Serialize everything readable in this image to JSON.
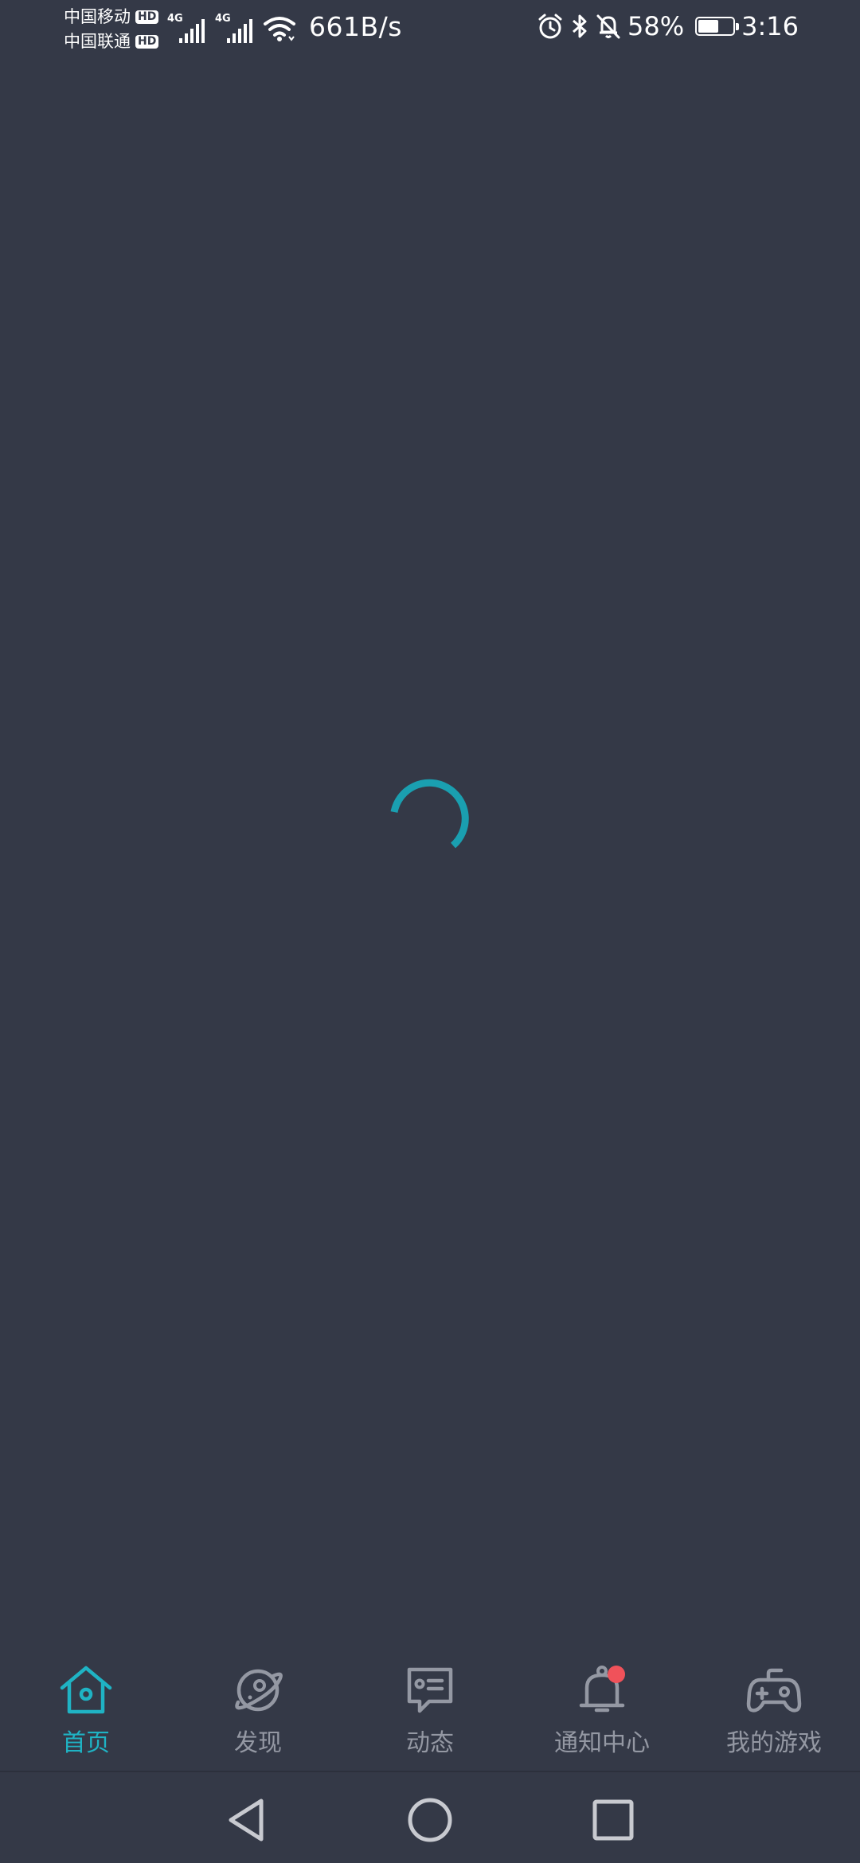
{
  "status_bar": {
    "carrier_1": "中国移动",
    "carrier_2": "中国联通",
    "hd_label": "HD",
    "signal_label": "4G",
    "net_speed": "661B/s",
    "battery_percent": "58%",
    "battery_level": 0.58,
    "time": "3:16",
    "icons": [
      "alarm-icon",
      "bluetooth-icon",
      "mute-bell-icon",
      "wifi-icon",
      "signal-icon",
      "battery-icon"
    ]
  },
  "loading": {
    "icon": "loading-spinner-icon",
    "color": "#1a9fb0"
  },
  "bottom_nav": {
    "active_color": "#1fb3c4",
    "inactive_color": "#9498a3",
    "badge_color": "#f0525a",
    "items": [
      {
        "label": "首页",
        "icon": "home-icon",
        "active": true
      },
      {
        "label": "发现",
        "icon": "planet-icon",
        "active": false
      },
      {
        "label": "动态",
        "icon": "feed-icon",
        "active": false
      },
      {
        "label": "通知中心",
        "icon": "bell-icon",
        "active": false,
        "has_badge": true
      },
      {
        "label": "我的游戏",
        "icon": "gamepad-icon",
        "active": false
      }
    ]
  },
  "system_nav": {
    "buttons": [
      "back-icon",
      "home-circle-icon",
      "recents-icon"
    ]
  }
}
